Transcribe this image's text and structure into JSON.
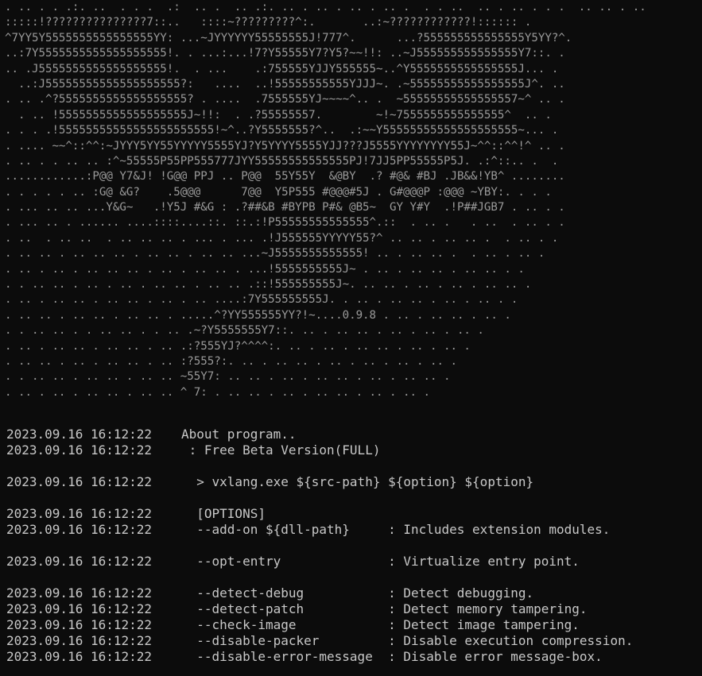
{
  "banner": {
    "lines": [
      ". .. . . .:. ..  . . .  .:  .. .  .. .:. .. . .. . .. . .. .  . . ..  .. . .. . . .  .. .. . ..",
      ":::::!???????????????7::..   ::::~?????????^:.       ..:~????????????!:::::: .",
      "^7YY5Y5555555555555555YY: ...~JYYYYYY55555555J!777^.      ...?555555555555555Y5YY?^.",
      "..:7Y5555555555555555555!. . ...:...!7?Y55555Y7?Y5?~~!!: ..~J555555555555555Y7::. .",
      ".. .J5555555555555555555!.  . ...    .:755555YJJY555555~..^Y5555555555555555J... .",
      "  ..:J55555555555555555555?:   ....  ..!55555555555YJJJ~. .~55555555555555555J^. ..",
      ". .. .^?5555555555555555555? . ....  .7555555YJ~~~~^.. .  ~55555555555555557~^ .. .",
      "  . .. !5555555555555555555J~!!:  . .?55555557.        ~!~7555555555555555^  .. .",
      ". . . .!55555555555555555555555!~^..?Y5555555?^..  .:~~Y55555555555555555555~... .",
      ". .... ~~^::^^:~JYYY5YY55YYYYY5555YJ?Y5YYYY5555YJJ???J5555YYYYYYYY55J~^^::^^!^ .. .",
      ". .. . . .. .. :^~55555P55PP555777JYY55555555555555PJ!7JJ5PP55555P5J. .:^::.. .  .",
      "............:P@@ Y7&J! !G@@ PPJ .. P@@  55Y55Y  &@BY  .? #@& #BJ .JB&&!YB^ ........",
      ". . . . . .. :G@ &G?    .5@@@      7@@  Y5P555 #@@@#5J . G#@@@P :@@@ ~YBY:. . . .",
      ". ... .. .. ...Y&G~   .!Y5J #&G : .?##&B #BYPB P#& @B5~  GY Y#Y  .!P##JGB7 . .. . .",
      ". ... .. . ...... ....::::....::. ::.:!P55555555555555^.::  . .. .   . ..  . .. . .",
      ". ..  . .. ..  . .. .. .. . ... . ... .!J555555YYYYY55?^ .. .. . .. .. .  . .. . .",
      ". .. .. . .. .. .. . .. .. . .. .. ...~J5555555555555! .. . .. .. .  . .. . .. .",
      ". .. . .. . .. .. .. . .. . .. .. . ...!5555555555J~ . .. . .. .. . .. .. . .",
      ". . .. .. . .. . .. . .. .. . .. .. .::!555555555J~. .. .. . .. . .. . .. .. .",
      ". .. . .. .. . .. .. . .. . .. ....:7Y555555555J. . .. . .. .. . .. . .. . .",
      ". .. .. . .. .. . .. .. . .....^?YY555555YY?!~....0.9.8 . .. . .. .. . .. .",
      ". . .. .. . . .. .. . . .. .~?Y5555555Y7::. .. . .. .. . .. . .. . .. .",
      ". .. . .. .. . .. .. . .. .:?555YJ?^^^^:. .. . .. . .. .. . .. . .. .",
      ". .. .. . .. . .. .. . .. :?555?:. .. . .. .. . .. . .. . .. . .. .",
      ". . .. .. . .. .. . .. .. ~55Y7: .. .. . .. . .. .. . .. . .. .. .",
      ". .. . .. . .. .. . .. .. ^ 7: . .. .. . .. . .. .. . .. . .. ."
    ]
  },
  "log": {
    "timestamp": "2023.09.16 16:12:22",
    "rows": [
      {
        "ts": "2023.09.16 16:12:22",
        "msg": "About program.."
      },
      {
        "ts": "2023.09.16 16:12:22",
        "msg": " : Free Beta Version(FULL)"
      },
      {
        "gap": true
      },
      {
        "ts": "2023.09.16 16:12:22",
        "msg": "  > vxlang.exe ${src-path} ${option} ${option}"
      },
      {
        "gap": true
      },
      {
        "ts": "2023.09.16 16:12:22",
        "msg": "  [OPTIONS]"
      },
      {
        "ts": "2023.09.16 16:12:22",
        "msg": "  --add-on ${dll-path}     : Includes extension modules."
      },
      {
        "gap": true
      },
      {
        "ts": "2023.09.16 16:12:22",
        "msg": "  --opt-entry              : Virtualize entry point."
      },
      {
        "gap": true
      },
      {
        "ts": "2023.09.16 16:12:22",
        "msg": "  --detect-debug           : Detect debugging."
      },
      {
        "ts": "2023.09.16 16:12:22",
        "msg": "  --detect-patch           : Detect memory tampering."
      },
      {
        "ts": "2023.09.16 16:12:22",
        "msg": "  --check-image            : Detect image tampering."
      },
      {
        "ts": "2023.09.16 16:12:22",
        "msg": "  --disable-packer         : Disable execution compression."
      },
      {
        "ts": "2023.09.16 16:12:22",
        "msg": "  --disable-error-message  : Disable error message-box."
      }
    ]
  },
  "colors": {
    "background": "#0c0c0c",
    "text": "#c8c8c8",
    "banner": "#9a9a9a"
  }
}
